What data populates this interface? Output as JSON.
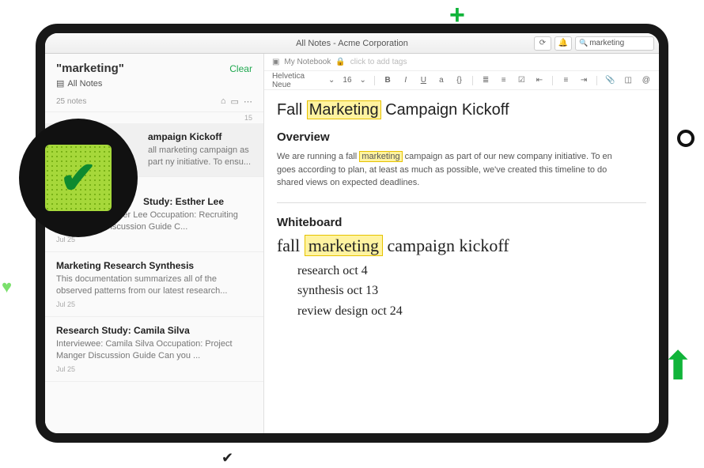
{
  "window_title": "All Notes - Acme Corporation",
  "search": {
    "value": "marketing"
  },
  "sidebar": {
    "query": "\"marketing\"",
    "clear": "Clear",
    "scope": "All Notes",
    "count": "25 notes",
    "date_sep": "15",
    "items": [
      {
        "title": "ampaign Kickoff",
        "snippet": "all marketing campaign as part ny initiative. To ensu...",
        "date": ""
      },
      {
        "title": "Study: Esther Lee",
        "snippet": "Interviewee: Esther Lee Occupation: Recruiting Coordinator Discussion Guide C...",
        "date": "Jul 25"
      },
      {
        "title": "Marketing Research Synthesis",
        "snippet": "This documentation summarizes all of the observed patterns from our latest research...",
        "date": "Jul 25"
      },
      {
        "title": "Research Study: Camila Silva",
        "snippet": "Interviewee: Camila Silva Occupation: Project Manger Discussion Guide Can you ...",
        "date": "Jul 25"
      }
    ]
  },
  "crumb": {
    "notebook": "My Notebook",
    "tags_ph": "click to add tags"
  },
  "toolbar": {
    "font": "Helvetica Neue",
    "size": "16"
  },
  "doc": {
    "title_pre": "Fall ",
    "title_hl": "Marketing",
    "title_post": " Campaign Kickoff",
    "h_overview": "Overview",
    "p1a": "We are running a fall ",
    "p1hl": "marketing",
    "p1b": " campaign as part of our new company initiative. To en",
    "p2": "goes according to plan, at least as much as possible, we've created this timeline to do",
    "p3": "shared views on expected deadlines.",
    "h_wb": "Whiteboard",
    "hand_pre": "fall ",
    "hand_hl": "marketing",
    "hand_post": " campaign kickoff",
    "tasks": [
      "research   oct 4",
      "synthesis   oct 13",
      "review design   oct 24"
    ]
  }
}
